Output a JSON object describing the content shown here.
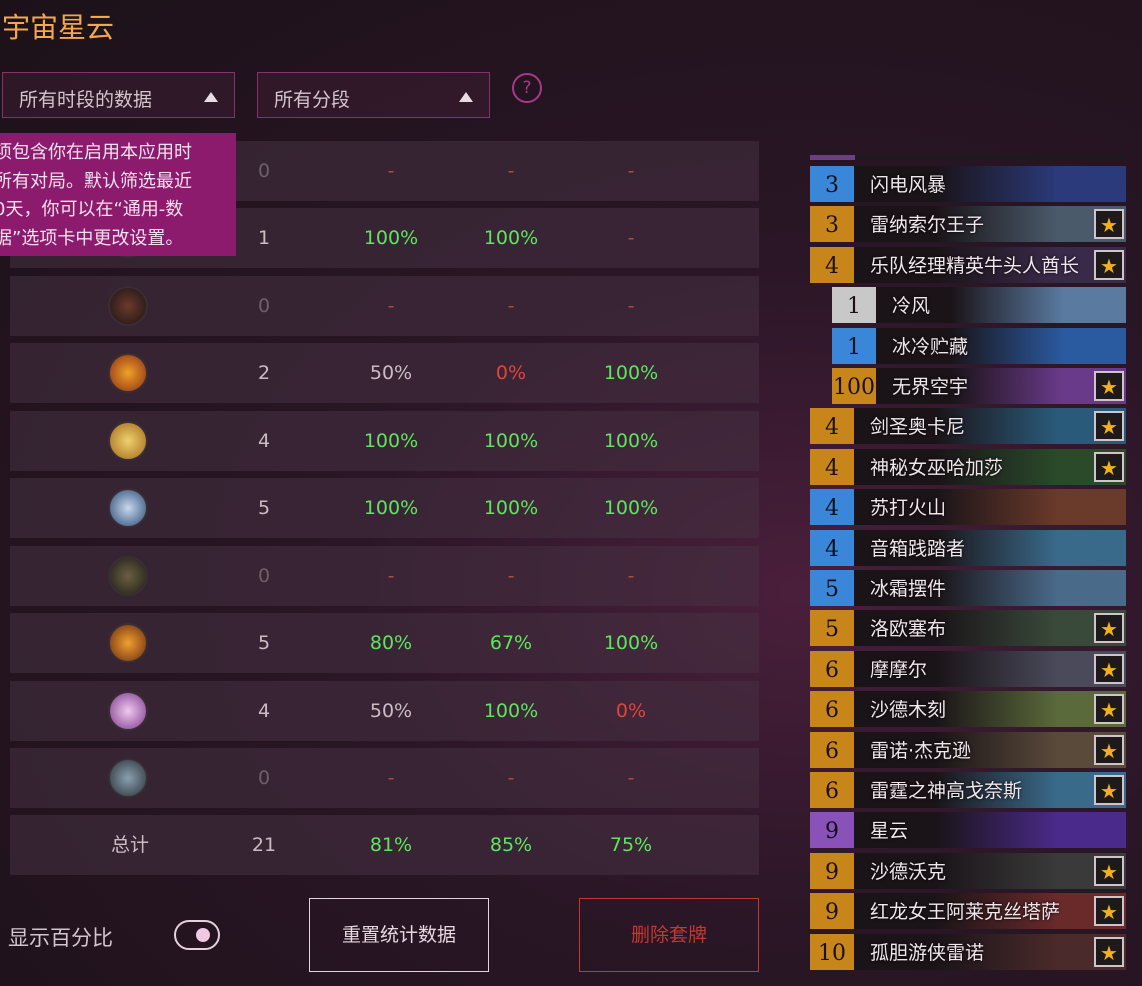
{
  "title": "宇宙星云",
  "filters": {
    "time_label": "所有时段的数据",
    "rank_label": "所有分段",
    "help_symbol": "?"
  },
  "tooltip_lines": [
    "项包含你在启用本应用时",
    "所有对局。默认筛选最近",
    "0天，你可以在“通用-数",
    "据”选项卡中更改设置。"
  ],
  "colors": {
    "green": "#5de65d",
    "red": "#e0453a",
    "dash": "#b04a45",
    "neutral": "#cbbcc4",
    "accent": "#f4a84c"
  },
  "stats_rows": [
    {
      "icon": "hidden-class-icon",
      "games": "0",
      "p1": "-",
      "p2": "-",
      "p3": "-",
      "c1": "dash",
      "c2": "dash",
      "c3": "dash"
    },
    {
      "icon": "hidden-class-icon",
      "games": "1",
      "p1": "100%",
      "p2": "100%",
      "p3": "-",
      "c1": "green",
      "c2": "green",
      "c3": "dash"
    },
    {
      "icon": "demon-hunter-class-icon",
      "games": "0",
      "p1": "-",
      "p2": "-",
      "p3": "-",
      "c1": "dash",
      "c2": "dash",
      "c3": "dash"
    },
    {
      "icon": "druid-class-icon",
      "games": "2",
      "p1": "50%",
      "p2": "0%",
      "p3": "100%",
      "c1": "neutral",
      "c2": "red",
      "c3": "green"
    },
    {
      "icon": "hunter-class-icon",
      "games": "4",
      "p1": "100%",
      "p2": "100%",
      "p3": "100%",
      "c1": "green",
      "c2": "green",
      "c3": "green"
    },
    {
      "icon": "mage-class-icon",
      "games": "5",
      "p1": "100%",
      "p2": "100%",
      "p3": "100%",
      "c1": "green",
      "c2": "green",
      "c3": "green"
    },
    {
      "icon": "paladin-class-icon",
      "games": "0",
      "p1": "-",
      "p2": "-",
      "p3": "-",
      "c1": "dash",
      "c2": "dash",
      "c3": "dash"
    },
    {
      "icon": "priest-class-icon",
      "games": "5",
      "p1": "80%",
      "p2": "67%",
      "p3": "100%",
      "c1": "green",
      "c2": "green",
      "c3": "green"
    },
    {
      "icon": "rogue-class-icon",
      "games": "4",
      "p1": "50%",
      "p2": "100%",
      "p3": "0%",
      "c1": "neutral",
      "c2": "green",
      "c3": "red"
    },
    {
      "icon": "warrior-class-icon",
      "games": "0",
      "p1": "-",
      "p2": "-",
      "p3": "-",
      "c1": "dash",
      "c2": "dash",
      "c3": "dash"
    }
  ],
  "total_row": {
    "label": "总计",
    "games": "21",
    "p1": "81%",
    "p2": "85%",
    "p3": "75%"
  },
  "toggle": {
    "label": "显示百分比",
    "on": true
  },
  "buttons": {
    "reset": "重置统计数据",
    "delete": "删除套牌"
  },
  "deck": [
    {
      "cost": "3",
      "name": "闪电风暴",
      "legendary": false,
      "rarity": "rare"
    },
    {
      "cost": "3",
      "name": "雷纳索尔王子",
      "legendary": true,
      "rarity": "legendary"
    },
    {
      "cost": "4",
      "name": "乐队经理精英牛头人酋长",
      "legendary": true,
      "rarity": "legendary"
    },
    {
      "cost": "1",
      "name": "冷风",
      "legendary": false,
      "rarity": "common",
      "sub": true
    },
    {
      "cost": "1",
      "name": "冰冷贮藏",
      "legendary": false,
      "rarity": "rare",
      "sub": true
    },
    {
      "cost": "100",
      "name": "无界空宇",
      "legendary": true,
      "rarity": "legendary",
      "sub": true
    },
    {
      "cost": "4",
      "name": "剑圣奥卡尼",
      "legendary": true,
      "rarity": "legendary"
    },
    {
      "cost": "4",
      "name": "神秘女巫哈加莎",
      "legendary": true,
      "rarity": "legendary"
    },
    {
      "cost": "4",
      "name": "苏打火山",
      "legendary": false,
      "rarity": "rare"
    },
    {
      "cost": "4",
      "name": "音箱践踏者",
      "legendary": false,
      "rarity": "rare"
    },
    {
      "cost": "5",
      "name": "冰霜摆件",
      "legendary": false,
      "rarity": "rare"
    },
    {
      "cost": "5",
      "name": "洛欧塞布",
      "legendary": true,
      "rarity": "legendary"
    },
    {
      "cost": "6",
      "name": "摩摩尔",
      "legendary": true,
      "rarity": "legendary"
    },
    {
      "cost": "6",
      "name": "沙德木刻",
      "legendary": true,
      "rarity": "legendary"
    },
    {
      "cost": "6",
      "name": "雷诺·杰克逊",
      "legendary": true,
      "rarity": "legendary"
    },
    {
      "cost": "6",
      "name": "雷霆之神高戈奈斯",
      "legendary": true,
      "rarity": "legendary"
    },
    {
      "cost": "9",
      "name": "星云",
      "legendary": false,
      "rarity": "epic"
    },
    {
      "cost": "9",
      "name": "沙德沃克",
      "legendary": true,
      "rarity": "legendary"
    },
    {
      "cost": "9",
      "name": "红龙女王阿莱克丝塔萨",
      "legendary": true,
      "rarity": "legendary"
    },
    {
      "cost": "10",
      "name": "孤胆游侠雷诺",
      "legendary": true,
      "rarity": "legendary"
    }
  ]
}
